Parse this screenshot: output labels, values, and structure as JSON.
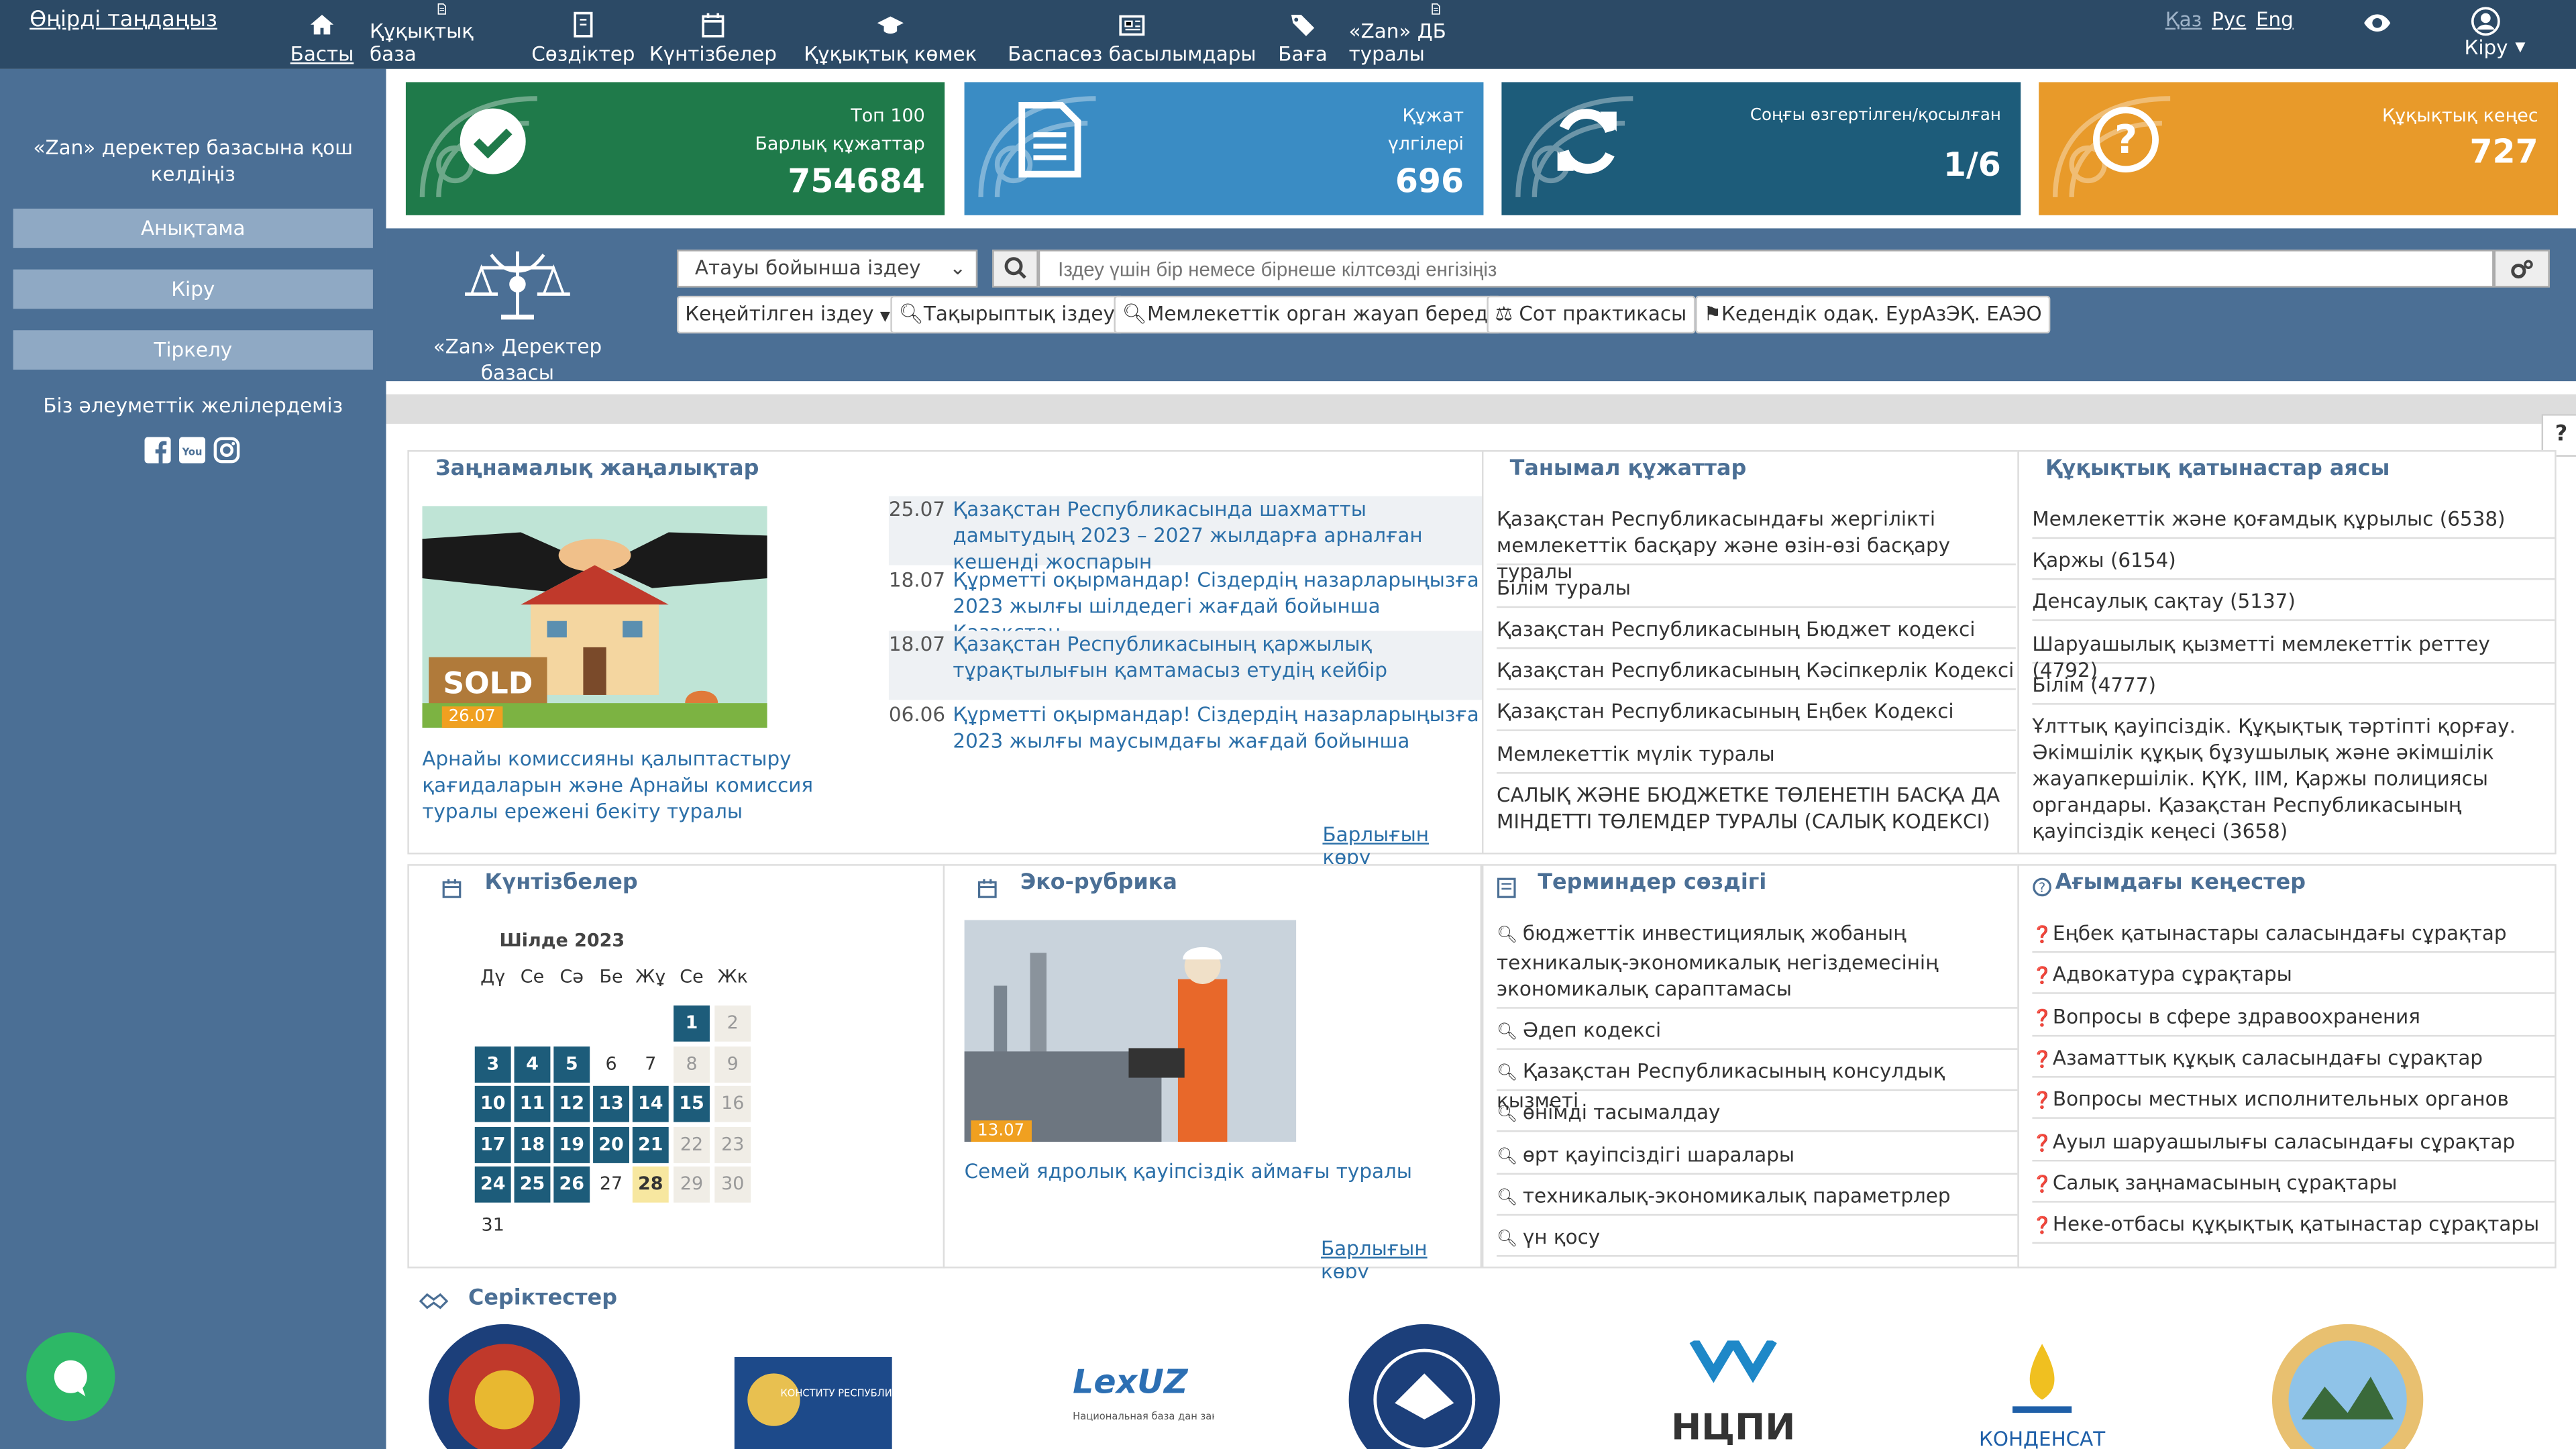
{
  "topbar": {
    "region": "Өңірді таңдаңыз",
    "nav": [
      "Басты",
      "Құқықтық база",
      "Сөздіктер",
      "Күнтізбелер",
      "Құқықтық көмек",
      "Баспасөз басылымдары",
      "Баға",
      "«Zan» ДБ туралы"
    ],
    "langs": [
      "Қаз",
      "Рус",
      "Eng"
    ],
    "login": "Кіру"
  },
  "sidebar": {
    "intro": "«Zan» деректер базасына қош келдіңіз",
    "buttons": [
      "Анықтама",
      "Кіру",
      "Тіркелу"
    ],
    "social": "Біз әлеуметтік желілердеміз"
  },
  "tiles": [
    {
      "line1": "Топ 100",
      "line2": "Барлық құжаттар",
      "num": "754684",
      "color": "#1f7a4a"
    },
    {
      "line1": "Құжат",
      "line2": "үлгілері",
      "num": "696",
      "color": "#3a8cc4"
    },
    {
      "line1": "Соңғы өзгертілген/қосылған",
      "line2": "",
      "num": "1/6",
      "color": "#1d5c7a"
    },
    {
      "line1": "Құқықтық кеңес",
      "line2": "",
      "num": "727",
      "color": "#e89a2a"
    }
  ],
  "search": {
    "logo": "«Zan» Деректер базасы",
    "select": "Атауы бойынша іздеу",
    "placeholder": "Іздеу үшін бір немесе бірнеше кілтсөзді енгізіңіз",
    "pills": [
      "Кеңейтілген іздеу",
      "Тақырыптық іздеу",
      "Мемлекеттік орган жауап береді",
      "Сот практикасы",
      "Кедендік одақ. ЕурАзЭҚ. ЕАЭО"
    ]
  },
  "news": {
    "title": "Заңнамалық жаңалықтар",
    "img_date": "26.07",
    "caption": "Арнайы комиссияны қалыптастыру қағидаларын және Арнайы комиссия туралы ережені бекіту туралы",
    "items": [
      {
        "d": "25.07",
        "t": "Қазақстан Республикасында шахматты дамытудың 2023 – 2027 жылдарға арналған кешенді жоспарын"
      },
      {
        "d": "18.07",
        "t": "Құрметті оқырмандар! Сіздердің назарларыңызға 2023 жылғы шілдедегі жағдай бойынша Қазақстан"
      },
      {
        "d": "18.07",
        "t": "Қазақстан Республикасының қаржылық тұрақтылығын қамтамасыз етудің кейбір"
      },
      {
        "d": "06.06",
        "t": "Құрметті оқырмандар! Сіздердің назарларыңызға 2023 жылғы маусымдағы жағдай бойынша"
      }
    ],
    "seeall": "Барлығын көру"
  },
  "popular": {
    "title": "Танымал құжаттар",
    "items": [
      "Қазақстан Республикасындағы жергілікті мемлекеттік басқару және өзін-өзі басқару туралы",
      "Білім туралы",
      "Қазақстан Республикасының Бюджет кодексі",
      "Қазақстан Республикасының Кәсіпкерлік Кодексі",
      "Қазақстан Республикасының Еңбек Кодексі",
      "Мемлекеттік мүлік туралы",
      "САЛЫҚ ЖӘНЕ БЮДЖЕТКЕ ТӨЛЕНЕТІН БАСҚА ДА МІНДЕТТІ ТӨЛЕМДЕР ТУРАЛЫ (САЛЫҚ КОДЕКСІ)"
    ]
  },
  "legal": {
    "title": "Құқықтық қатынастар аясы",
    "items": [
      "Мемлекеттік және қоғамдық құрылыс (6538)",
      "Қаржы (6154)",
      "Денсаулық сақтау (5137)",
      "Шаруашылық қызметті мемлекеттік реттеу (4792)",
      "Білім (4777)",
      "Ұлттық қауіпсіздік. Құқықтық тәртіпті қорғау. Әкімшілік құқық бұзушылық және әкімшілік жауапкершілік. ҚҮК, ІІМ, Қаржы полициясы органдары. Қазақстан Республикасының қауіпсіздік кеңесі (3658)"
    ]
  },
  "calendar": {
    "title": "Күнтізбелер",
    "month": "Шілде 2023",
    "days": [
      "Дү",
      "Се",
      "Сә",
      "Бе",
      "Жұ",
      "Се",
      "Жк"
    ]
  },
  "eco": {
    "title": "Эко-рубрика",
    "img_date": "13.07",
    "caption": "Семей ядролық қауіпсіздік аймағы туралы",
    "seeall": "Барлығын көру"
  },
  "terms": {
    "title": "Терминдер сөздігі",
    "items": [
      "бюджеттік инвестициялық жобаның техникалық-экономикалық негіздемесінің экономикалық сараптамасы",
      "Әдеп кодексі",
      "Қазақстан Республикасының консулдық қызметі",
      "өнімді тасымалдау",
      "өрт қауіпсіздігі шаралары",
      "техникалық-экономикалық параметрлер",
      "үн қосу"
    ]
  },
  "advice": {
    "title": "Ағымдағы кеңестер",
    "items": [
      "Еңбек қатынастары саласындағы сұрақтар",
      "Адвокатура сұрақтары",
      "Вопросы в сфере здравоохранения",
      "Азаматтық құқық саласындағы сұрақтар",
      "Вопросы местных исполнительных органов",
      "Ауыл шаруашылығы саласындағы сұрақтар",
      "Салық заңнамасының сұрақтары",
      "Неке-отбасы құқықтық қатынастар сұрақтары"
    ]
  },
  "partners": {
    "title": "Серіктестер",
    "labels": [
      "КОНСТИТУ РЕСПУБЛИ",
      "LexUZ on-line",
      "Национальная база дан законодательства Респу",
      "НЦПИ",
      "КОНДЕНСАТ"
    ]
  }
}
